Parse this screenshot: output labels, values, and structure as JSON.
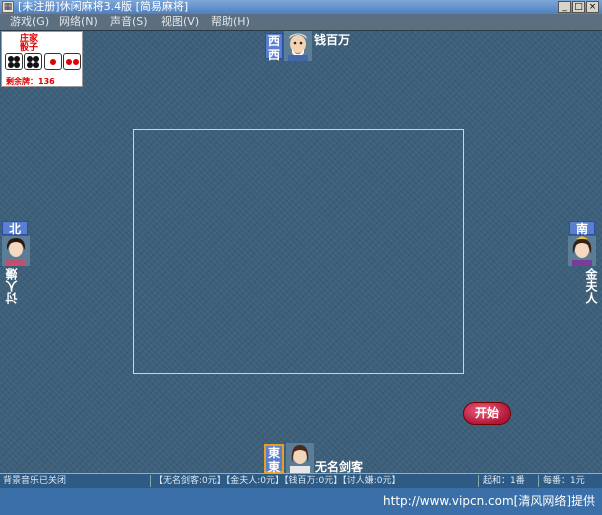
{
  "window": {
    "title": "[未注册]休闲麻将3.4版 [简易麻将]",
    "icon": "mahjong-app-icon",
    "controls": [
      "_",
      "□",
      "×"
    ]
  },
  "menu": [
    {
      "label": "游戏(G)"
    },
    {
      "label": "网络(N)"
    },
    {
      "label": "声音(S)"
    },
    {
      "label": "视图(V)"
    },
    {
      "label": "帮助(H)"
    }
  ],
  "dice": {
    "label1": "庄家",
    "label2": "骰子",
    "values": [
      4,
      4,
      1,
      2
    ],
    "note": "剩余牌：136"
  },
  "players": {
    "top": {
      "wind": "西",
      "name": "钱百万"
    },
    "left": {
      "wind": "北",
      "name": "讨人嫌"
    },
    "right": {
      "wind": "南",
      "name": "金夫人"
    },
    "bottom": {
      "wind": "東",
      "name": "无名剑客"
    }
  },
  "start_button": {
    "label": "开始"
  },
  "status": {
    "music": "背景音乐已关闭",
    "scores": "【无名剑客:0元】【金夫人:0元】【钱百万:0元】【讨人嫌:0元】",
    "base": "起和：1番",
    "per_fan": "每番：1元"
  },
  "watermark": "http://www.vipcn.com[清风网络]提供",
  "colors": {
    "table": "#3c5f7a",
    "wind_tile": "#5a7fd0",
    "start_button": "#c0203f",
    "status_bar": "#2e5b86"
  }
}
